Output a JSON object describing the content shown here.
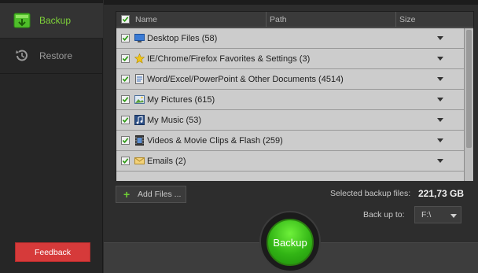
{
  "sidebar": {
    "items": [
      {
        "label": "Backup",
        "icon": "backup-icon",
        "active": true
      },
      {
        "label": "Restore",
        "icon": "restore-icon",
        "active": false
      }
    ],
    "feedback_label": "Feedback"
  },
  "filelist": {
    "columns": {
      "name": "Name",
      "path": "Path",
      "size": "Size"
    },
    "rows": [
      {
        "label": "Desktop Files (58)",
        "icon": "desktop-icon",
        "checked": true
      },
      {
        "label": "IE/Chrome/Firefox Favorites & Settings (3)",
        "icon": "star-icon",
        "checked": true
      },
      {
        "label": "Word/Excel/PowerPoint & Other Documents (4514)",
        "icon": "document-icon",
        "checked": true
      },
      {
        "label": "My Pictures (615)",
        "icon": "picture-icon",
        "checked": true
      },
      {
        "label": "My Music (53)",
        "icon": "music-icon",
        "checked": true
      },
      {
        "label": "Videos & Movie Clips & Flash (259)",
        "icon": "video-icon",
        "checked": true
      },
      {
        "label": "Emails (2)",
        "icon": "email-icon",
        "checked": true
      }
    ]
  },
  "actions": {
    "add_files_label": "Add Files ...",
    "selected_label": "Selected backup files:",
    "selected_value": "221,73 GB",
    "backup_to_label": "Back up to:",
    "backup_to_value": "F:\\",
    "backup_button_label": "Backup"
  },
  "colors": {
    "accent_green": "#6fcf35",
    "feedback_red": "#d63a3a",
    "row_bg": "#cccccc"
  }
}
